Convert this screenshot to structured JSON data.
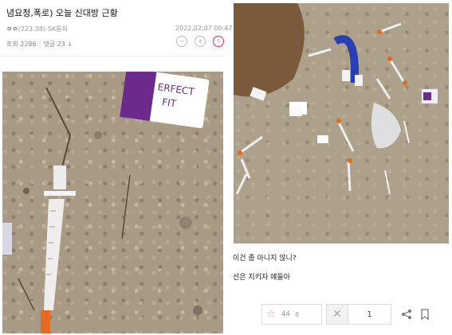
{
  "post": {
    "title": "념요청,폭로) 오늘 신대방 근황",
    "author": "ㅇㅇ",
    "ip": "(223.38)",
    "carrier": "-SK통피",
    "date": "2022.02.07 00:47",
    "views_label": "조회 2286",
    "comments_label": "댓글 23 ↓"
  },
  "photo1": {
    "packet_text_line1": "ERFECT",
    "packet_text_line2": "FIT"
  },
  "captions": {
    "line1": "이건 좀 아니지 않니?",
    "line2": "선은 지키자 얘들아"
  },
  "actions": {
    "like_count": "44",
    "like_sub": "8",
    "dislike_count": "1"
  },
  "colors": {
    "alarm": "#ee2266",
    "like_star": "#e8a9b8",
    "packet_purple": "#6b2a8c",
    "syringe_orange": "#e36a1e",
    "blue_strap": "#2a3fb3"
  }
}
